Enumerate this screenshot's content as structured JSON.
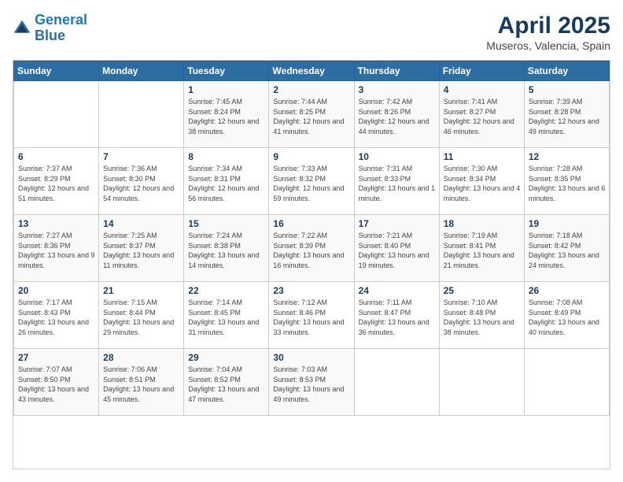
{
  "logo": {
    "line1": "General",
    "line2": "Blue"
  },
  "header": {
    "title": "April 2025",
    "subtitle": "Museros, Valencia, Spain"
  },
  "weekdays": [
    "Sunday",
    "Monday",
    "Tuesday",
    "Wednesday",
    "Thursday",
    "Friday",
    "Saturday"
  ],
  "weeks": [
    [
      {
        "day": "",
        "sunrise": "",
        "sunset": "",
        "daylight": ""
      },
      {
        "day": "",
        "sunrise": "",
        "sunset": "",
        "daylight": ""
      },
      {
        "day": "1",
        "sunrise": "Sunrise: 7:45 AM",
        "sunset": "Sunset: 8:24 PM",
        "daylight": "Daylight: 12 hours and 38 minutes."
      },
      {
        "day": "2",
        "sunrise": "Sunrise: 7:44 AM",
        "sunset": "Sunset: 8:25 PM",
        "daylight": "Daylight: 12 hours and 41 minutes."
      },
      {
        "day": "3",
        "sunrise": "Sunrise: 7:42 AM",
        "sunset": "Sunset: 8:26 PM",
        "daylight": "Daylight: 12 hours and 44 minutes."
      },
      {
        "day": "4",
        "sunrise": "Sunrise: 7:41 AM",
        "sunset": "Sunset: 8:27 PM",
        "daylight": "Daylight: 12 hours and 46 minutes."
      },
      {
        "day": "5",
        "sunrise": "Sunrise: 7:39 AM",
        "sunset": "Sunset: 8:28 PM",
        "daylight": "Daylight: 12 hours and 49 minutes."
      }
    ],
    [
      {
        "day": "6",
        "sunrise": "Sunrise: 7:37 AM",
        "sunset": "Sunset: 8:29 PM",
        "daylight": "Daylight: 12 hours and 51 minutes."
      },
      {
        "day": "7",
        "sunrise": "Sunrise: 7:36 AM",
        "sunset": "Sunset: 8:30 PM",
        "daylight": "Daylight: 12 hours and 54 minutes."
      },
      {
        "day": "8",
        "sunrise": "Sunrise: 7:34 AM",
        "sunset": "Sunset: 8:31 PM",
        "daylight": "Daylight: 12 hours and 56 minutes."
      },
      {
        "day": "9",
        "sunrise": "Sunrise: 7:33 AM",
        "sunset": "Sunset: 8:32 PM",
        "daylight": "Daylight: 12 hours and 59 minutes."
      },
      {
        "day": "10",
        "sunrise": "Sunrise: 7:31 AM",
        "sunset": "Sunset: 8:33 PM",
        "daylight": "Daylight: 13 hours and 1 minute."
      },
      {
        "day": "11",
        "sunrise": "Sunrise: 7:30 AM",
        "sunset": "Sunset: 8:34 PM",
        "daylight": "Daylight: 13 hours and 4 minutes."
      },
      {
        "day": "12",
        "sunrise": "Sunrise: 7:28 AM",
        "sunset": "Sunset: 8:35 PM",
        "daylight": "Daylight: 13 hours and 6 minutes."
      }
    ],
    [
      {
        "day": "13",
        "sunrise": "Sunrise: 7:27 AM",
        "sunset": "Sunset: 8:36 PM",
        "daylight": "Daylight: 13 hours and 9 minutes."
      },
      {
        "day": "14",
        "sunrise": "Sunrise: 7:25 AM",
        "sunset": "Sunset: 8:37 PM",
        "daylight": "Daylight: 13 hours and 11 minutes."
      },
      {
        "day": "15",
        "sunrise": "Sunrise: 7:24 AM",
        "sunset": "Sunset: 8:38 PM",
        "daylight": "Daylight: 13 hours and 14 minutes."
      },
      {
        "day": "16",
        "sunrise": "Sunrise: 7:22 AM",
        "sunset": "Sunset: 8:39 PM",
        "daylight": "Daylight: 13 hours and 16 minutes."
      },
      {
        "day": "17",
        "sunrise": "Sunrise: 7:21 AM",
        "sunset": "Sunset: 8:40 PM",
        "daylight": "Daylight: 13 hours and 19 minutes."
      },
      {
        "day": "18",
        "sunrise": "Sunrise: 7:19 AM",
        "sunset": "Sunset: 8:41 PM",
        "daylight": "Daylight: 13 hours and 21 minutes."
      },
      {
        "day": "19",
        "sunrise": "Sunrise: 7:18 AM",
        "sunset": "Sunset: 8:42 PM",
        "daylight": "Daylight: 13 hours and 24 minutes."
      }
    ],
    [
      {
        "day": "20",
        "sunrise": "Sunrise: 7:17 AM",
        "sunset": "Sunset: 8:43 PM",
        "daylight": "Daylight: 13 hours and 26 minutes."
      },
      {
        "day": "21",
        "sunrise": "Sunrise: 7:15 AM",
        "sunset": "Sunset: 8:44 PM",
        "daylight": "Daylight: 13 hours and 29 minutes."
      },
      {
        "day": "22",
        "sunrise": "Sunrise: 7:14 AM",
        "sunset": "Sunset: 8:45 PM",
        "daylight": "Daylight: 13 hours and 31 minutes."
      },
      {
        "day": "23",
        "sunrise": "Sunrise: 7:12 AM",
        "sunset": "Sunset: 8:46 PM",
        "daylight": "Daylight: 13 hours and 33 minutes."
      },
      {
        "day": "24",
        "sunrise": "Sunrise: 7:11 AM",
        "sunset": "Sunset: 8:47 PM",
        "daylight": "Daylight: 13 hours and 36 minutes."
      },
      {
        "day": "25",
        "sunrise": "Sunrise: 7:10 AM",
        "sunset": "Sunset: 8:48 PM",
        "daylight": "Daylight: 13 hours and 38 minutes."
      },
      {
        "day": "26",
        "sunrise": "Sunrise: 7:08 AM",
        "sunset": "Sunset: 8:49 PM",
        "daylight": "Daylight: 13 hours and 40 minutes."
      }
    ],
    [
      {
        "day": "27",
        "sunrise": "Sunrise: 7:07 AM",
        "sunset": "Sunset: 8:50 PM",
        "daylight": "Daylight: 13 hours and 43 minutes."
      },
      {
        "day": "28",
        "sunrise": "Sunrise: 7:06 AM",
        "sunset": "Sunset: 8:51 PM",
        "daylight": "Daylight: 13 hours and 45 minutes."
      },
      {
        "day": "29",
        "sunrise": "Sunrise: 7:04 AM",
        "sunset": "Sunset: 8:52 PM",
        "daylight": "Daylight: 13 hours and 47 minutes."
      },
      {
        "day": "30",
        "sunrise": "Sunrise: 7:03 AM",
        "sunset": "Sunset: 8:53 PM",
        "daylight": "Daylight: 13 hours and 49 minutes."
      },
      {
        "day": "",
        "sunrise": "",
        "sunset": "",
        "daylight": ""
      },
      {
        "day": "",
        "sunrise": "",
        "sunset": "",
        "daylight": ""
      },
      {
        "day": "",
        "sunrise": "",
        "sunset": "",
        "daylight": ""
      }
    ]
  ]
}
